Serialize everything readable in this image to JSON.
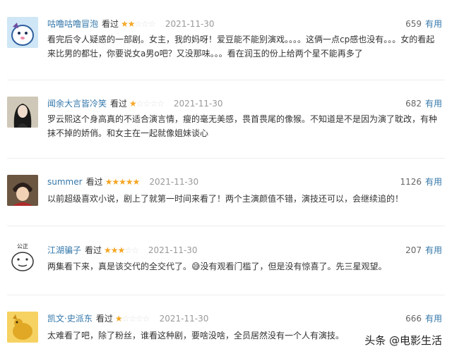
{
  "reviews": [
    {
      "username": "咕噜咕噜冒泡",
      "action": "看过",
      "stars": "★★",
      "stars_off": "☆☆☆",
      "rating": 2,
      "date": "2021-11-30",
      "votes": "659",
      "useful_label": "有用",
      "text": "看完后令人疑惑的一部剧。女主，我的妈呀！爱豆能不能别演戏。。。。这俩一点cp感也没有。。。女的看起来比男的都壮，你要说女a男o吧？又没那味。。。看在润玉的份上给两个星不能再多了"
    },
    {
      "username": "闻余大言皆冷笑",
      "action": "看过",
      "stars": "★",
      "stars_off": "☆☆☆☆",
      "rating": 1,
      "date": "2021-11-30",
      "votes": "682",
      "useful_label": "有用",
      "text": "罗云熙这个身高真的不适合演言情，瘦的毫无美感，畏首畏尾的像猴。不知道是不是因为演了耽改，有种抹不掉的娇俏。和女主在一起就像姐妹谈心"
    },
    {
      "username": "summer",
      "action": "看过",
      "stars": "★★★★★",
      "stars_off": "",
      "rating": 5,
      "date": "2021-11-30",
      "votes": "1126",
      "useful_label": "有用",
      "text": "以前超级喜欢小说，剧上了就第一时间来看了！两个主演颜值不错，演技还可以，会继续追的！"
    },
    {
      "username": "江湖骗子",
      "action": "看过",
      "stars": "★★★",
      "stars_off": "☆☆",
      "rating": 3,
      "date": "2021-11-30",
      "votes": "207",
      "useful_label": "有用",
      "avatar_text": "公正",
      "text": "两集看下来，真是该交代的全交代了。😅没有观看门槛了，但是没有惊喜了。先三星观望。"
    },
    {
      "username": "凯文·史派东",
      "action": "看过",
      "stars": "★",
      "stars_off": "☆☆☆☆",
      "rating": 1,
      "date": "2021-11-30",
      "votes": "666",
      "useful_label": "有用",
      "text": "太难看了吧，除了粉丝，谁看这种剧，要啥没啥，全员居然没有一个人有演技。"
    }
  ],
  "watermark": "头条 @电影生活",
  "colors": {
    "link": "#3377aa",
    "star": "#f5a623",
    "date": "#999999"
  }
}
